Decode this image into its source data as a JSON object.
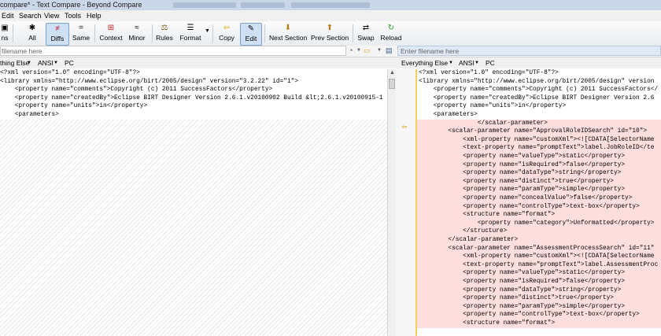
{
  "window": {
    "title": "compare* - Text Compare - Beyond Compare"
  },
  "menu": [
    "Edit",
    "Search",
    "View",
    "Tools",
    "Help"
  ],
  "toolbar": [
    {
      "label": "ns",
      "icon": "sessions-icon",
      "glyph": "▣"
    },
    {
      "label": "All",
      "icon": "all-icon",
      "glyph": "✱"
    },
    {
      "label": "Diffs",
      "icon": "diffs-icon",
      "glyph": "≠",
      "active": true
    },
    {
      "label": "Same",
      "icon": "same-icon",
      "glyph": "="
    },
    {
      "label": "Context",
      "icon": "context-icon",
      "glyph": "⊞"
    },
    {
      "label": "Minor",
      "icon": "minor-icon",
      "glyph": "≈"
    },
    {
      "label": "Rules",
      "icon": "rules-icon",
      "glyph": "⚖"
    },
    {
      "label": "Format",
      "icon": "format-icon",
      "glyph": "☰"
    },
    {
      "label": "Copy",
      "icon": "copy-icon",
      "glyph": "⇦"
    },
    {
      "label": "Edit",
      "icon": "edit-icon",
      "glyph": "✎",
      "active": true
    },
    {
      "label": "Next Section",
      "icon": "next-section-icon",
      "glyph": "⬇"
    },
    {
      "label": "Prev Section",
      "icon": "prev-section-icon",
      "glyph": "⬆"
    },
    {
      "label": "Swap",
      "icon": "swap-icon",
      "glyph": "⇄"
    },
    {
      "label": "Reload",
      "icon": "reload-icon",
      "glyph": "↻"
    }
  ],
  "left": {
    "path_placeholder": "filename here",
    "format": "thing Else",
    "encoding": "ANSI",
    "line_ending": "PC",
    "lines": [
      "<?xml version=\"1.0\" encoding=\"UTF-8\"?>",
      "<library xmlns=\"http://www.eclipse.org/birt/2005/design\" version=\"3.2.22\" id=\"1\">",
      "    <property name=\"comments\">Copyright (c) 2011 SuccessFactors</property>",
      "    <property name=\"createdBy\">Eclipse BIRT Designer Version 2.6.1.v20100902 Build &lt;2.6.1.v20100915-1",
      "    <property name=\"units\">in</property>",
      "    <parameters>"
    ]
  },
  "right": {
    "path_placeholder": "Enter filename here",
    "format": "Everything Else",
    "encoding": "ANSI",
    "line_ending": "PC",
    "lines": [
      {
        "text": "<?xml version=\"1.0\" encoding=\"UTF-8\"?>",
        "diff": false
      },
      {
        "text": "<library xmlns=\"http://www.eclipse.org/birt/2005/design\" version",
        "diff": false
      },
      {
        "text": "    <property name=\"comments\">Copyright (c) 2011 SuccessFactors</",
        "diff": false
      },
      {
        "text": "    <property name=\"createdBy\">Eclipse BIRT Designer Version 2.6",
        "diff": false
      },
      {
        "text": "    <property name=\"units\">in</property>",
        "diff": false
      },
      {
        "text": "    <parameters>",
        "diff": false
      },
      {
        "text": "                </scalar-parameter>",
        "diff": true
      },
      {
        "text": "        <scalar-parameter name=\"ApprovalRoleIDSearch\" id=\"10\">",
        "diff": true
      },
      {
        "text": "            <xml-property name=\"customXml\"><![CDATA[SelectorName",
        "diff": true
      },
      {
        "text": "            <text-property name=\"promptText\">label.JobRoleID</te",
        "diff": true
      },
      {
        "text": "            <property name=\"valueType\">static</property>",
        "diff": true
      },
      {
        "text": "            <property name=\"isRequired\">false</property>",
        "diff": true
      },
      {
        "text": "            <property name=\"dataType\">string</property>",
        "diff": true
      },
      {
        "text": "            <property name=\"distinct\">true</property>",
        "diff": true
      },
      {
        "text": "            <property name=\"paramType\">simple</property>",
        "diff": true
      },
      {
        "text": "            <property name=\"concealValue\">false</property>",
        "diff": true
      },
      {
        "text": "            <property name=\"controlType\">text-box</property>",
        "diff": true
      },
      {
        "text": "            <structure name=\"format\">",
        "diff": true
      },
      {
        "text": "                <property name=\"category\">Unformatted</property>",
        "diff": true
      },
      {
        "text": "            </structure>",
        "diff": true
      },
      {
        "text": "        </scalar-parameter>",
        "diff": true
      },
      {
        "text": "        <scalar-parameter name=\"AssessmentProcessSearch\" id=\"11\"",
        "diff": true
      },
      {
        "text": "            <xml-property name=\"customXml\"><![CDATA[SelectorName",
        "diff": true
      },
      {
        "text": "            <text-property name=\"promptText\">label.AssessmentProc",
        "diff": true
      },
      {
        "text": "            <property name=\"valueType\">static</property>",
        "diff": true
      },
      {
        "text": "            <property name=\"isRequired\">false</property>",
        "diff": true
      },
      {
        "text": "            <property name=\"dataType\">string</property>",
        "diff": true
      },
      {
        "text": "            <property name=\"distinct\">true</property>",
        "diff": true
      },
      {
        "text": "            <property name=\"paramType\">simple</property>",
        "diff": true
      },
      {
        "text": "            <property name=\"controlType\">text-box</property>",
        "diff": true
      },
      {
        "text": "            <structure name=\"format\">",
        "diff": true
      }
    ]
  }
}
